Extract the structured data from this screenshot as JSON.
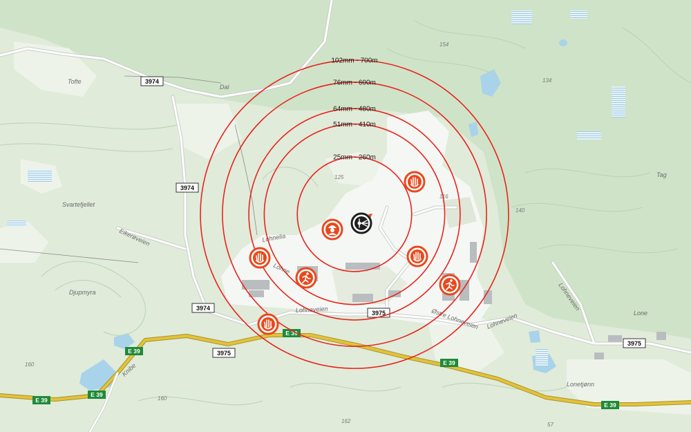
{
  "map": {
    "colors": {
      "forest": "#cfe3c8",
      "open_land": "#eef3ea",
      "industrial": "#f5f7f4",
      "water": "#a9d3ea",
      "contour": "#b9d2b4",
      "road_major": "#e2c23a",
      "road_minor": "#ffffff",
      "ring": "#e8231c",
      "marker": "#e8491d",
      "target": "#1f1f1f"
    },
    "rings": [
      {
        "id": "ring-25mm",
        "label": "25mm - 260m",
        "radius_m": 260
      },
      {
        "id": "ring-51mm",
        "label": "51mm - 410m",
        "radius_m": 410
      },
      {
        "id": "ring-64mm",
        "label": "64mm - 480m",
        "radius_m": 480
      },
      {
        "id": "ring-76mm",
        "label": "76mm - 600m",
        "radius_m": 600
      },
      {
        "id": "ring-102mm",
        "label": "102mm - 700m",
        "radius_m": 700
      }
    ],
    "place_labels": [
      {
        "id": "tofte",
        "text": "Tofte"
      },
      {
        "id": "dal",
        "text": "Dal"
      },
      {
        "id": "svartefjellet",
        "text": "Svartefjellet"
      },
      {
        "id": "eikeroveien",
        "text": "Eikerøveien"
      },
      {
        "id": "djupmyra",
        "text": "Djupmyra"
      },
      {
        "id": "lohnelia",
        "text": "Lohnelia"
      },
      {
        "id": "lohnevn-small",
        "text": "Lohne"
      },
      {
        "id": "lohneveien-1",
        "text": "Lohneveien"
      },
      {
        "id": "ostre-lohneveien",
        "text": "Østre Lohneveien"
      },
      {
        "id": "lohneveien-2",
        "text": "Lohneveien"
      },
      {
        "id": "lohneveien-3",
        "text": "Lohneveien"
      },
      {
        "id": "lone",
        "text": "Lone"
      },
      {
        "id": "lonetjonn",
        "text": "Lonetjønn"
      },
      {
        "id": "knibe",
        "text": "Knibe"
      },
      {
        "id": "tag",
        "text": "Tag"
      }
    ],
    "elevations": [
      "154",
      "134",
      "125",
      "116",
      "140",
      "160",
      "160",
      "162",
      "57"
    ],
    "road_shields": [
      "3974",
      "3974",
      "3974",
      "3975",
      "3975",
      "3975"
    ],
    "e_shields": [
      "E 39",
      "E 39",
      "E 39",
      "E 39",
      "E 39",
      "E 39"
    ],
    "markers": [
      {
        "id": "stop-hand-north",
        "icon": "hand-stop-icon"
      },
      {
        "id": "stop-hand-west",
        "icon": "hand-stop-icon"
      },
      {
        "id": "stop-hand-east",
        "icon": "hand-stop-icon"
      },
      {
        "id": "stop-hand-south",
        "icon": "hand-stop-icon"
      },
      {
        "id": "evacuate-west",
        "icon": "running-person-icon"
      },
      {
        "id": "evacuate-east",
        "icon": "running-person-icon"
      },
      {
        "id": "worker",
        "icon": "hardhat-worker-icon"
      },
      {
        "id": "blast-site",
        "icon": "explosion-icon"
      }
    ]
  }
}
